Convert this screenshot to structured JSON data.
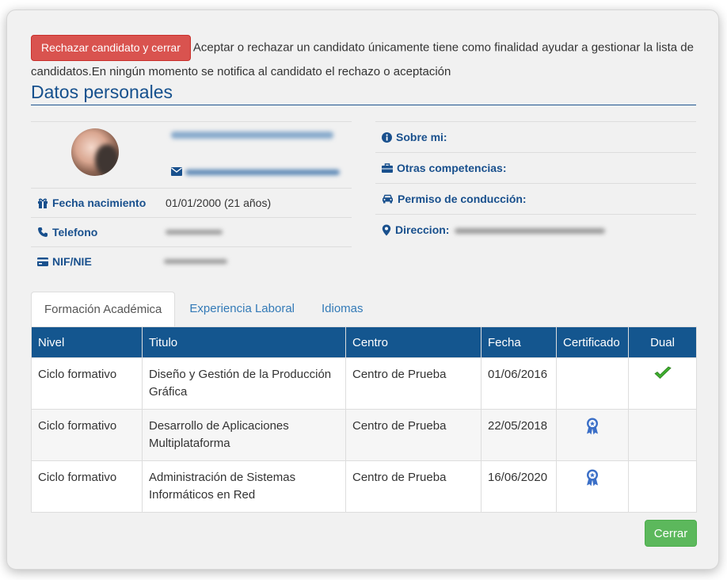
{
  "header": {
    "reject_label": "Rechazar candidato y cerrar",
    "notice": "Aceptar o rechazar un candidato únicamente tiene como finalidad ayudar a gestionar la lista de candidatos.En ningún momento se notifica al candidato el rechazo o aceptación"
  },
  "section_title": "Datos personales",
  "personal": {
    "fields": [
      {
        "label": "Fecha nacimiento",
        "value": "01/01/2000 (21 años)"
      },
      {
        "label": "Telefono",
        "value": ""
      },
      {
        "label": "NIF/NIE",
        "value": ""
      }
    ],
    "right": [
      {
        "label": "Sobre mi:"
      },
      {
        "label": "Otras competencias:"
      },
      {
        "label": "Permiso de conducción:"
      },
      {
        "label": "Direccion:"
      }
    ]
  },
  "tabs": [
    "Formación Académica",
    "Experiencia Laboral",
    "Idiomas"
  ],
  "table": {
    "headers": [
      "Nivel",
      "Titulo",
      "Centro",
      "Fecha",
      "Certificado",
      "Dual"
    ],
    "rows": [
      {
        "nivel": "Ciclo formativo",
        "titulo": "Diseño y Gestión de la Producción Gráfica",
        "centro": "Centro de Prueba",
        "fecha": "01/06/2016",
        "certificado": false,
        "dual": true
      },
      {
        "nivel": "Ciclo formativo",
        "titulo": "Desarrollo de Aplicaciones Multiplataforma",
        "centro": "Centro de Prueba",
        "fecha": "22/05/2018",
        "certificado": true,
        "dual": false
      },
      {
        "nivel": "Ciclo formativo",
        "titulo": "Administración de Sistemas Informáticos en Red",
        "centro": "Centro de Prueba",
        "fecha": "16/06/2020",
        "certificado": true,
        "dual": false
      }
    ]
  },
  "footer": {
    "close_label": "Cerrar"
  },
  "colors": {
    "brand": "#15508d",
    "reject": "#d9534f",
    "close": "#5cb85c",
    "header_bg": "#14568f"
  },
  "icons": [
    "gift-icon",
    "phone-icon",
    "id-card-icon",
    "info-circle-icon",
    "briefcase-icon",
    "car-icon",
    "map-marker-icon",
    "envelope-icon",
    "ribbon-award-icon",
    "check-icon"
  ]
}
